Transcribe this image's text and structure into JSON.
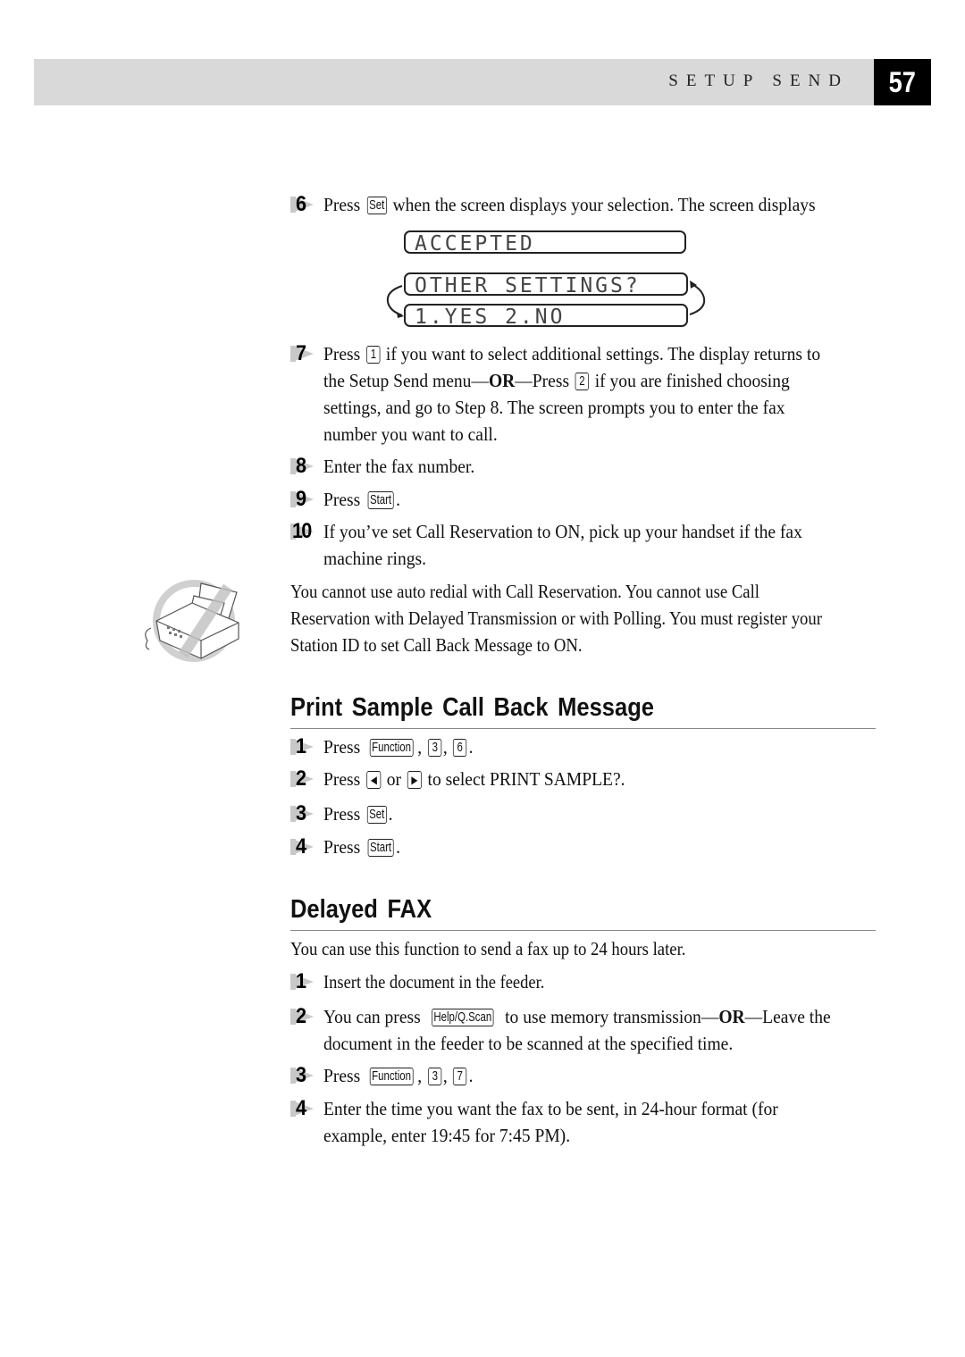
{
  "header": {
    "section_title": "SETUP SEND",
    "page_number": "57"
  },
  "setup_send_steps": [
    {
      "number": "6",
      "parts": [
        "Press ",
        "Set",
        " when the screen displays your selection. The screen displays"
      ]
    },
    {
      "number": "7",
      "lines": [
        "if you want to select additional settings. The display returns to",
        "the Setup Send menu—",
        "OR",
        "—Press ",
        "if you are finished choosing",
        "settings, and go to Step 8. The screen prompts you to enter the fax",
        "number you want to call."
      ],
      "key1": "1",
      "key2": "2",
      "press": "Press "
    },
    {
      "number": "8",
      "text": "Enter the fax number."
    },
    {
      "number": "9",
      "press": "Press ",
      "key": "Start",
      "suffix": "."
    },
    {
      "number": "10",
      "lines": [
        "If you’ve set Call Reservation to ON, pick up your handset if the fax",
        "machine rings."
      ]
    }
  ],
  "lcd": {
    "accepted": "ACCEPTED",
    "other_settings": "OTHER SETTINGS?",
    "options": "1.YES 2.NO"
  },
  "note": {
    "icon": "fax-machine-icon",
    "lines": [
      "You cannot use auto redial with Call Reservation. You cannot use Call",
      "Reservation with Delayed Transmission or with Polling. You must register your",
      "Station ID to set Call Back Message to ON."
    ]
  },
  "print_sample": {
    "title": "Print Sample Call Back Message",
    "steps": [
      {
        "number": "1",
        "press": "Press ",
        "keys": [
          "Function",
          "3",
          "6"
        ]
      },
      {
        "number": "2",
        "press": "Press ",
        "or": " or ",
        "suffix": " to select PRINT SAMPLE?.",
        "left_key": "left-arrow",
        "right_key": "right-arrow"
      },
      {
        "number": "3",
        "press": "Press ",
        "key": "Set",
        "suffix": "."
      },
      {
        "number": "4",
        "press": "Press ",
        "key": "Start",
        "suffix": "."
      }
    ]
  },
  "delayed_fax": {
    "title": "Delayed FAX",
    "intro": "You can use this function to send a fax up to 24 hours later.",
    "steps": [
      {
        "number": "1",
        "text": "Insert the document in the feeder."
      },
      {
        "number": "2",
        "prefix": "You can press ",
        "key": "Help/Q.Scan",
        "mid": " to use memory transmission—",
        "or": "OR",
        "tail": "—Leave the",
        "line2": "document in the feeder to be scanned at the specified time."
      },
      {
        "number": "3",
        "press": "Press ",
        "keys": [
          "Function",
          "3",
          "7"
        ]
      },
      {
        "number": "4",
        "lines": [
          "Enter the time you want the fax to be sent, in 24-hour format (for",
          "example, enter 19:45 for 7:45 PM)."
        ]
      }
    ]
  }
}
